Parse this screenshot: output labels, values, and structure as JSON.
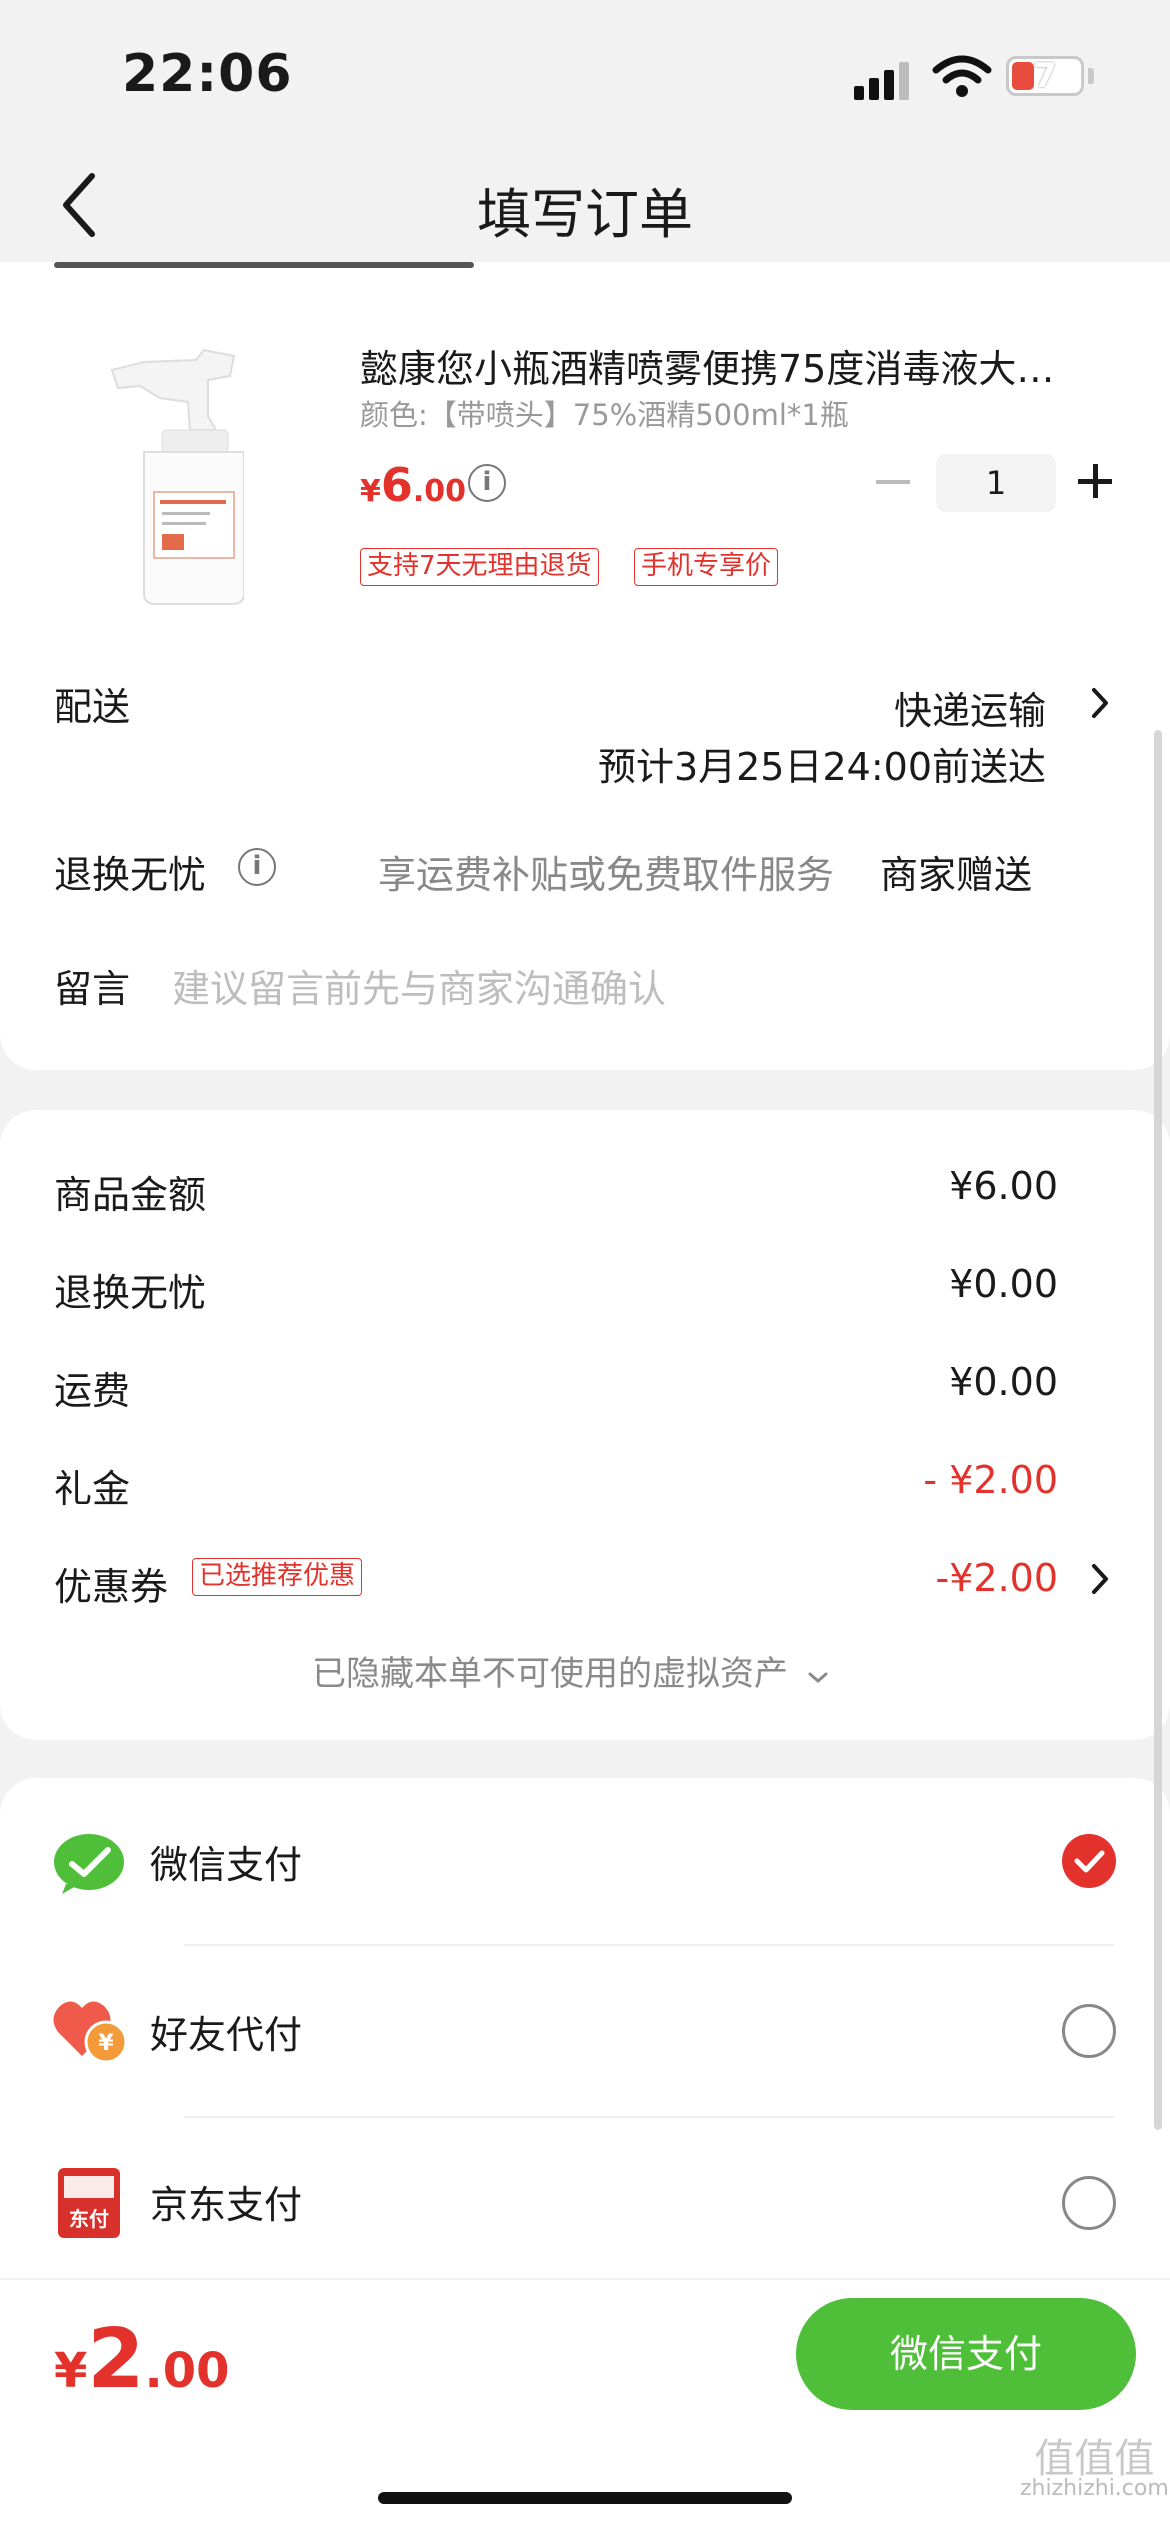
{
  "status_bar": {
    "time": "22:06",
    "battery": "7"
  },
  "nav": {
    "title": "填写订单"
  },
  "product": {
    "title": "懿康您小瓶酒精喷雾便携75度消毒液大…",
    "spec": "颜色:【带喷头】75%酒精500ml*1瓶",
    "price_symbol": "¥",
    "price_int": "6",
    "price_dec": ".00",
    "quantity": "1",
    "tags": [
      "支持7天无理由退货",
      "手机专享价"
    ]
  },
  "delivery": {
    "label": "配送",
    "method": "快递运输",
    "eta": "预计3月25日24:00前送达"
  },
  "return_service": {
    "label": "退换无忧",
    "desc": "享运费补贴或免费取件服务",
    "value": "商家赠送"
  },
  "message": {
    "label": "留言",
    "placeholder": "建议留言前先与商家沟通确认"
  },
  "summary": {
    "rows": [
      {
        "label": "商品金额",
        "value": "¥6.00"
      },
      {
        "label": "退换无忧",
        "value": "¥0.00"
      },
      {
        "label": "运费",
        "value": "¥0.00"
      },
      {
        "label": "礼金",
        "value": "- ¥2.00"
      }
    ],
    "coupon": {
      "label": "优惠券",
      "badge": "已选推荐优惠",
      "value": "-¥2.00"
    },
    "hidden_note": "已隐藏本单不可使用的虚拟资产"
  },
  "payment": {
    "options": [
      {
        "label": "微信支付",
        "icon": "wechat-pay-icon",
        "selected": true
      },
      {
        "label": "好友代付",
        "icon": "friend-pay-icon",
        "selected": false
      },
      {
        "label": "京东支付",
        "icon": "jd-pay-icon",
        "selected": false
      }
    ],
    "jd_icon_text": "东付",
    "friend_icon_text": "¥"
  },
  "bottom": {
    "total_symbol": "¥",
    "total_int": "2",
    "total_dec": ".00",
    "pay_button": "微信支付"
  },
  "watermark": {
    "line1": "值值值",
    "line2": "zhizhizhi.com"
  },
  "colors": {
    "accent_red": "#e3322b",
    "wechat_green": "#4fbf3a",
    "background": "#f2f2f2"
  }
}
